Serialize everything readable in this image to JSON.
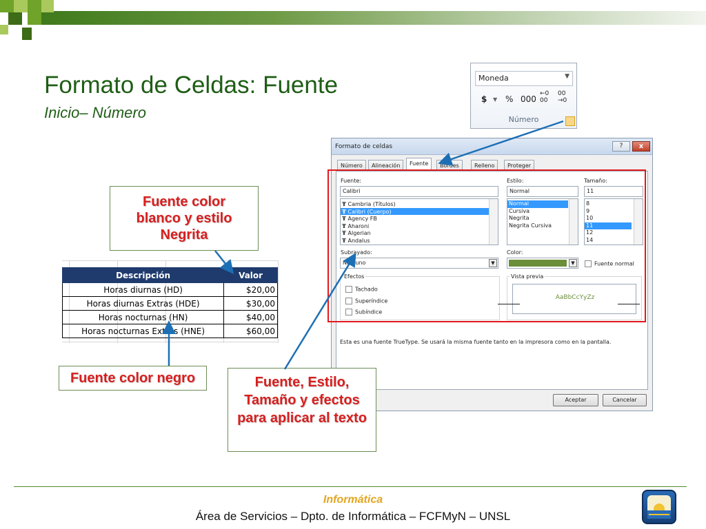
{
  "slide": {
    "title": "Formato de Celdas: Fuente",
    "subtitle_part1": "Inicio",
    "subtitle_part2": "– Número"
  },
  "ribbon": {
    "format_value": "Moneda",
    "currency_symbol": "$",
    "percent_symbol": "%",
    "thousands_label": "000",
    "increase_decimals_label": "←0\n00",
    "decrease_decimals_label": "00\n→0",
    "group_label": "Número"
  },
  "dialog": {
    "title": "Formato de celdas",
    "help_label": "?",
    "close_label": "x",
    "tabs": [
      "Número",
      "Alineación",
      "Fuente",
      "Bordes",
      "Relleno",
      "Proteger"
    ],
    "font_label": "Fuente:",
    "font_value": "Calibri",
    "font_list": [
      "Cambria (Títulos)",
      "Calibri (Cuerpo)",
      "Agency FB",
      "Aharoni",
      "Algerian",
      "Andalus"
    ],
    "style_label": "Estilo:",
    "style_value": "Normal",
    "style_list": [
      "Normal",
      "Cursiva",
      "Negrita",
      "Negrita Cursiva"
    ],
    "size_label": "Tamaño:",
    "size_value": "11",
    "size_list": [
      "8",
      "9",
      "10",
      "11",
      "12",
      "14"
    ],
    "underline_label": "Subrayado:",
    "underline_value": "Ninguno",
    "color_label": "Color:",
    "color_value": "#6b8e3a",
    "normal_font_label": "Fuente normal",
    "effects_label": "Efectos",
    "effects": [
      "Tachado",
      "Superíndice",
      "Subíndice"
    ],
    "preview_label": "Vista previa",
    "preview_text": "AaBbCcYyZz",
    "info_text": "Esta es una fuente TrueType. Se usará la misma fuente tanto en la impresora como en la pantalla.",
    "accept_label": "Aceptar",
    "cancel_label": "Cancelar"
  },
  "table": {
    "headers": [
      "Descripción",
      "Valor"
    ],
    "rows": [
      [
        "Horas diurnas (HD)",
        "$20,00"
      ],
      [
        "Horas diurnas Extras (HDE)",
        "$30,00"
      ],
      [
        "Horas nocturnas (HN)",
        "$40,00"
      ],
      [
        "Horas nocturnas Extras (HNE)",
        "$60,00"
      ]
    ]
  },
  "callouts": {
    "white_bold": "Fuente color blanco y estilo Negrita",
    "black": "Fuente color negro",
    "font_style": "Fuente, Estilo, Tamaño y efectos para aplicar al texto"
  },
  "footer": {
    "line1": "Informática",
    "line2": "Área de Servicios – Dpto. de Informática – FCFMyN – UNSL"
  },
  "colors": {
    "title_green": "#1f5d16",
    "callout_red": "#d81f1f",
    "arrow_blue": "#1d6fb5",
    "highlight_red": "#e3171b",
    "header_navy": "#1f3b6e",
    "footer_orange": "#e3a51e"
  }
}
